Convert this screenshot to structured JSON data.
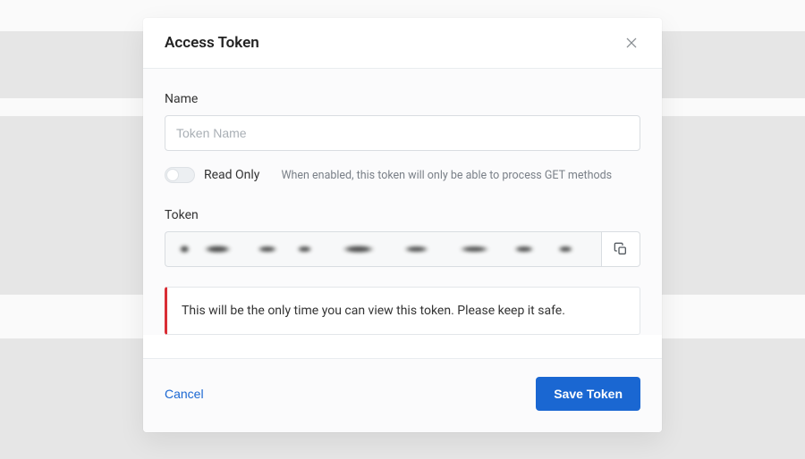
{
  "modal": {
    "title": "Access Token",
    "name_label": "Name",
    "name_placeholder": "Token Name",
    "name_value": "",
    "readonly_label": "Read Only",
    "readonly_hint": "When enabled, this token will only be able to process GET methods",
    "token_label": "Token",
    "warning_text": "This will be the only time you can view this token. Please keep it safe.",
    "cancel_label": "Cancel",
    "save_label": "Save Token"
  },
  "colors": {
    "primary": "#1a67d2",
    "danger": "#d92d35"
  }
}
